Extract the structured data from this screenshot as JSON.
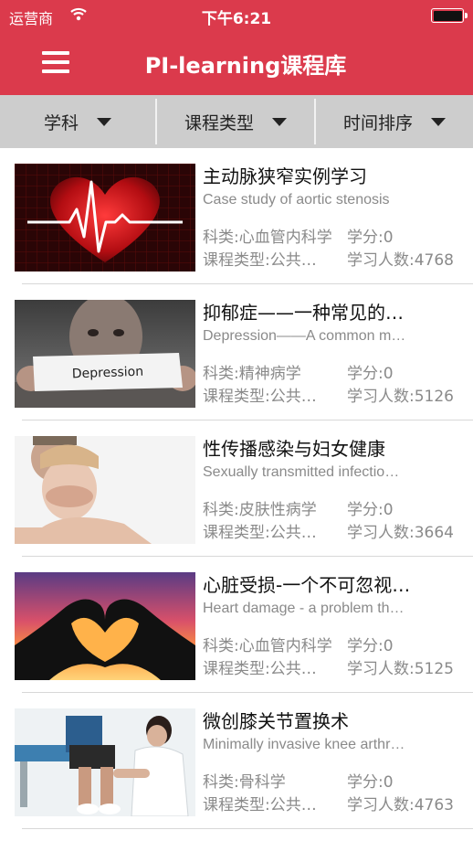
{
  "status_bar": {
    "carrier": "运营商",
    "time": "下午6:21"
  },
  "header": {
    "title": "PI-learning课程库"
  },
  "filters": [
    {
      "label": "学科"
    },
    {
      "label": "课程类型"
    },
    {
      "label": "时间排序"
    }
  ],
  "courses": [
    {
      "title": "主动脉狭窄实例学习",
      "subtitle": "Case study of aortic stenosis",
      "category": "科类:心血管内科学",
      "credit": "学分:0",
      "type": "课程类型:公共…",
      "learners": "学习人数:4768",
      "thumb_icon": "heartbeat-heart-image"
    },
    {
      "title": "抑郁症——一种常见的…",
      "subtitle": "Depression——A common m…",
      "category": "科类:精神病学",
      "credit": "学分:0",
      "type": "课程类型:公共…",
      "learners": "学习人数:5126",
      "thumb_icon": "depression-sign-image",
      "thumb_text": "Depression"
    },
    {
      "title": "性传播感染与妇女健康",
      "subtitle": "Sexually transmitted infectio…",
      "category": "科类:皮肤性病学",
      "credit": "学分:0",
      "type": "课程类型:公共…",
      "learners": "学习人数:3664",
      "thumb_icon": "covered-mouth-image"
    },
    {
      "title": "心脏受损-一个不可忽视…",
      "subtitle": "Heart damage - a problem th…",
      "category": "科类:心血管内科学",
      "credit": "学分:0",
      "type": "课程类型:公共…",
      "learners": "学习人数:5125",
      "thumb_icon": "heart-hands-sunset-image"
    },
    {
      "title": "微创膝关节置换术",
      "subtitle": "Minimally invasive knee arthr…",
      "category": "科类:骨科学",
      "credit": "学分:0",
      "type": "课程类型:公共…",
      "learners": "学习人数:4763",
      "thumb_icon": "knee-exam-image"
    }
  ],
  "colors": {
    "brand": "#db3a4c",
    "filter_bg": "#cdcdcd",
    "muted_text": "#8a8a8a"
  }
}
